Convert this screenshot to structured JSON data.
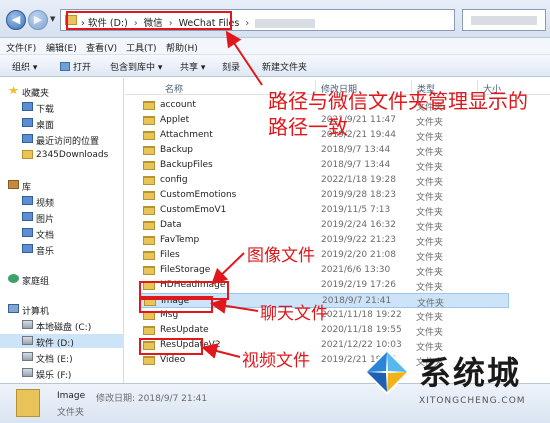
{
  "address": {
    "segments": [
      "软件 (D:)",
      "微信",
      "WeChat Files"
    ],
    "separator": "›"
  },
  "menu": [
    "文件(F)",
    "编辑(E)",
    "查看(V)",
    "工具(T)",
    "帮助(H)"
  ],
  "toolbar": {
    "organize": "组织 ▾",
    "open": "打开",
    "include_library": "包含到库中 ▾",
    "share": "共享 ▾",
    "burn": "刻录",
    "new_folder": "新建文件夹"
  },
  "sidebar": {
    "favorites": {
      "label": "收藏夹",
      "items": [
        "下载",
        "桌面",
        "最近访问的位置",
        "2345Downloads"
      ]
    },
    "libraries": {
      "label": "库",
      "items": [
        "视频",
        "图片",
        "文档",
        "音乐"
      ]
    },
    "homegroup": "家庭组",
    "computer": {
      "label": "计算机",
      "items": [
        "本地磁盘 (C:)",
        "软件 (D:)",
        "文档 (E:)",
        "娱乐 (F:)"
      ]
    }
  },
  "columns": {
    "name": "名称",
    "date": "修改日期",
    "type": "类型",
    "size": "大小"
  },
  "files": [
    {
      "name": "account",
      "date": "",
      "type": "文件夹"
    },
    {
      "name": "Applet",
      "date": "2021/9/21 11:47",
      "type": "文件夹"
    },
    {
      "name": "Attachment",
      "date": "2019/2/21 19:44",
      "type": "文件夹"
    },
    {
      "name": "Backup",
      "date": "2018/9/7 13:44",
      "type": "文件夹"
    },
    {
      "name": "BackupFiles",
      "date": "2018/9/7 13:44",
      "type": "文件夹"
    },
    {
      "name": "config",
      "date": "2022/1/18 19:28",
      "type": "文件夹"
    },
    {
      "name": "CustomEmotions",
      "date": "2019/9/28 18:23",
      "type": "文件夹"
    },
    {
      "name": "CustomEmoV1",
      "date": "2019/11/5 7:13",
      "type": "文件夹"
    },
    {
      "name": "Data",
      "date": "2019/2/24 16:32",
      "type": "文件夹"
    },
    {
      "name": "FavTemp",
      "date": "2019/9/22 21:23",
      "type": "文件夹"
    },
    {
      "name": "Files",
      "date": "2019/2/20 21:08",
      "type": "文件夹"
    },
    {
      "name": "FileStorage",
      "date": "2021/6/6 13:30",
      "type": "文件夹"
    },
    {
      "name": "HDHeadImage",
      "date": "2019/2/19 17:26",
      "type": "文件夹"
    },
    {
      "name": "Image",
      "date": "2018/9/7 21:41",
      "type": "文件夹"
    },
    {
      "name": "Msg",
      "date": "2021/11/18 19:22",
      "type": "文件夹"
    },
    {
      "name": "ResUpdate",
      "date": "2020/11/18 19:55",
      "type": "文件夹"
    },
    {
      "name": "ResUpdateV2",
      "date": "2021/12/22 10:03",
      "type": "文件夹"
    },
    {
      "name": "Video",
      "date": "2019/2/21 19:55",
      "type": "文件夹"
    }
  ],
  "annotations": {
    "path_note_line1": "路径与微信文件夹管理显示的",
    "path_note_line2": "路径一致",
    "image_note": "图像文件",
    "msg_note": "聊天文件",
    "video_note": "视频文件"
  },
  "status": {
    "name": "Image",
    "meta": "修改日期: 2018/9/7 21:41",
    "type": "文件夹"
  },
  "watermark": {
    "title": "系统城",
    "subtitle": "XITONGCHENG.COM"
  },
  "colors": {
    "annotation_red": "#e0181b",
    "selection": "#cde3f7"
  }
}
